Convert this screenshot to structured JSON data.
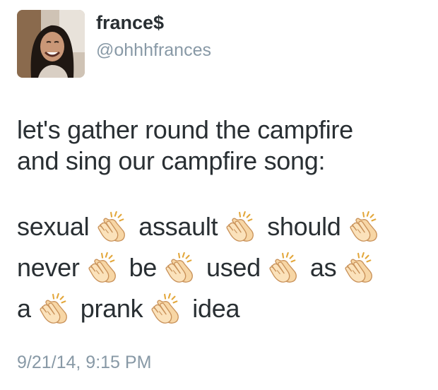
{
  "user": {
    "display_name": "france$",
    "handle": "@ohhhfrances"
  },
  "tweet": {
    "intro_line_1": "let's gather round the campfire",
    "intro_line_2": "and sing our campfire song:",
    "song_lines": [
      [
        "sexual",
        "assault",
        "should"
      ],
      [
        "never",
        "be",
        "used",
        "as"
      ],
      [
        "a",
        "prank",
        "idea"
      ]
    ],
    "timestamp": "9/21/14, 9:15 PM"
  },
  "icons": {
    "avatar": "profile-photo",
    "clap": "clapping-hands-icon"
  },
  "colors": {
    "text": "#292f33",
    "secondary": "#8899a6",
    "skin": "#f7d6a5"
  }
}
